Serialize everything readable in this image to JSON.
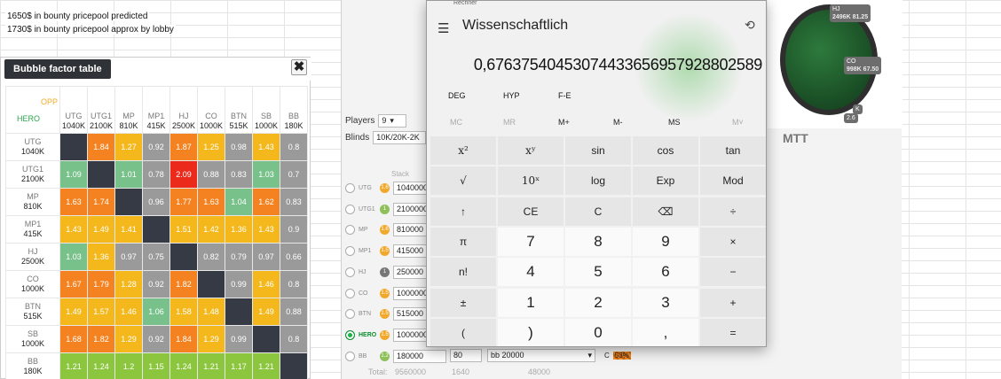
{
  "notes": [
    "1650$ in bounty pricepool predicted",
    "1730$ in bounty pricepool approx by lobby"
  ],
  "bubble": {
    "title": "Bubble factor table",
    "close": "✖",
    "corner_opp": "OPP",
    "corner_hero": "HERO",
    "cols": [
      {
        "pos": "UTG",
        "stack": "1040K"
      },
      {
        "pos": "UTG1",
        "stack": "2100K"
      },
      {
        "pos": "MP",
        "stack": "810K"
      },
      {
        "pos": "MP1",
        "stack": "415K"
      },
      {
        "pos": "HJ",
        "stack": "2500K"
      },
      {
        "pos": "CO",
        "stack": "1000K"
      },
      {
        "pos": "BTN",
        "stack": "515K"
      },
      {
        "pos": "SB",
        "stack": "1000K"
      },
      {
        "pos": "BB",
        "stack": "180K"
      }
    ],
    "rows": [
      {
        "pos": "UTG",
        "stack": "1040K",
        "cells": [
          [
            "",
            "dk"
          ],
          [
            "1.84",
            "or"
          ],
          [
            "1.27",
            "ye"
          ],
          [
            "0.92",
            "gr"
          ],
          [
            "1.87",
            "or"
          ],
          [
            "1.25",
            "ye"
          ],
          [
            "0.98",
            "gr"
          ],
          [
            "1.43",
            "ye"
          ],
          [
            "0.8",
            "gr"
          ]
        ]
      },
      {
        "pos": "UTG1",
        "stack": "2100K",
        "cells": [
          [
            "1.09",
            "gn"
          ],
          [
            "",
            "dk"
          ],
          [
            "1.01",
            "gn"
          ],
          [
            "0.78",
            "gr"
          ],
          [
            "2.09",
            "rd"
          ],
          [
            "0.88",
            "gr"
          ],
          [
            "0.83",
            "gr"
          ],
          [
            "1.03",
            "gn"
          ],
          [
            "0.7",
            "gr"
          ]
        ]
      },
      {
        "pos": "MP",
        "stack": "810K",
        "cells": [
          [
            "1.63",
            "or"
          ],
          [
            "1.74",
            "or"
          ],
          [
            "",
            "dk"
          ],
          [
            "0.96",
            "gr"
          ],
          [
            "1.77",
            "or"
          ],
          [
            "1.63",
            "or"
          ],
          [
            "1.04",
            "gn"
          ],
          [
            "1.62",
            "or"
          ],
          [
            "0.83",
            "gr"
          ]
        ]
      },
      {
        "pos": "MP1",
        "stack": "415K",
        "cells": [
          [
            "1.43",
            "ye"
          ],
          [
            "1.49",
            "ye"
          ],
          [
            "1.41",
            "ye"
          ],
          [
            "",
            "dk"
          ],
          [
            "1.51",
            "ye"
          ],
          [
            "1.42",
            "ye"
          ],
          [
            "1.36",
            "ye"
          ],
          [
            "1.43",
            "ye"
          ],
          [
            "0.9",
            "gr"
          ]
        ]
      },
      {
        "pos": "HJ",
        "stack": "2500K",
        "cells": [
          [
            "1.03",
            "gn"
          ],
          [
            "1.36",
            "ye"
          ],
          [
            "0.97",
            "gr"
          ],
          [
            "0.75",
            "gr"
          ],
          [
            "",
            "dk"
          ],
          [
            "0.82",
            "gr"
          ],
          [
            "0.79",
            "gr"
          ],
          [
            "0.97",
            "gr"
          ],
          [
            "0.66",
            "gr"
          ]
        ]
      },
      {
        "pos": "CO",
        "stack": "1000K",
        "cells": [
          [
            "1.67",
            "or"
          ],
          [
            "1.79",
            "or"
          ],
          [
            "1.28",
            "ye"
          ],
          [
            "0.92",
            "gr"
          ],
          [
            "1.82",
            "or"
          ],
          [
            "",
            "dk"
          ],
          [
            "0.99",
            "gr"
          ],
          [
            "1.46",
            "ye"
          ],
          [
            "0.8",
            "gr"
          ]
        ]
      },
      {
        "pos": "BTN",
        "stack": "515K",
        "cells": [
          [
            "1.49",
            "ye"
          ],
          [
            "1.57",
            "ye"
          ],
          [
            "1.46",
            "ye"
          ],
          [
            "1.06",
            "gn"
          ],
          [
            "1.58",
            "ye"
          ],
          [
            "1.48",
            "ye"
          ],
          [
            "",
            "dk"
          ],
          [
            "1.49",
            "ye"
          ],
          [
            "0.88",
            "gr"
          ]
        ]
      },
      {
        "pos": "SB",
        "stack": "1000K",
        "cells": [
          [
            "1.68",
            "or"
          ],
          [
            "1.82",
            "or"
          ],
          [
            "1.29",
            "ye"
          ],
          [
            "0.92",
            "gr"
          ],
          [
            "1.84",
            "or"
          ],
          [
            "1.29",
            "ye"
          ],
          [
            "0.99",
            "gr"
          ],
          [
            "",
            "dk"
          ],
          [
            "0.8",
            "gr"
          ]
        ]
      },
      {
        "pos": "BB",
        "stack": "180K",
        "cells": [
          [
            "1.21",
            "lg"
          ],
          [
            "1.24",
            "lg"
          ],
          [
            "1.2",
            "lg"
          ],
          [
            "1.15",
            "lg"
          ],
          [
            "1.24",
            "lg"
          ],
          [
            "1.21",
            "lg"
          ],
          [
            "1.17",
            "lg"
          ],
          [
            "1.21",
            "lg"
          ],
          [
            "",
            "dk"
          ]
        ]
      }
    ]
  },
  "app": {
    "players_label": "Players",
    "players_value": "9",
    "blinds_label": "Blinds",
    "blinds_value": "10K/20K-2K",
    "stack_header": "Stack",
    "seats": [
      {
        "pos": "UTG",
        "coin": "1.6",
        "stack": "1040000"
      },
      {
        "pos": "UTG1",
        "coin": "1",
        "stack": "2100000"
      },
      {
        "pos": "MP",
        "coin": "1.6",
        "stack": "810000"
      },
      {
        "pos": "MP1",
        "coin": "1.5",
        "stack": "415000"
      },
      {
        "pos": "HJ",
        "coin": "1",
        "stack": "250000"
      },
      {
        "pos": "CO",
        "coin": "1.5",
        "stack": "1000000"
      },
      {
        "pos": "BTN",
        "coin": "1.5",
        "stack": "515000"
      },
      {
        "pos": "HERO",
        "coin": "1.5",
        "stack": "1000000"
      },
      {
        "pos": "BB",
        "coin": "1.2",
        "stack": "180000"
      }
    ],
    "bb_extra": "80",
    "bb_select": "bb 20000",
    "total_label": "Total:",
    "total_values": [
      "9560000",
      "1640",
      "48000"
    ],
    "mtt": "MTT",
    "pct": "53%",
    "pct_prefix": "C",
    "table_seats": [
      {
        "name": "HJ",
        "val": "2496K 81.25"
      },
      {
        "name": "CO",
        "val": "998K 67.50"
      },
      {
        "name": "K",
        "val": ""
      },
      {
        "name": "",
        "val": "2.6"
      }
    ]
  },
  "calc": {
    "titlebar": "Rechner",
    "mode": "Wissenschaftlich",
    "display": "0,676375404530744336569579288025 89",
    "display_text": "0,6763754045307443365695792880258 9",
    "display_shown": "0,676375404530744336569579288025 89",
    "value": "0,67637540453074433656957928802589",
    "modes": [
      "DEG",
      "HYP",
      "F-E"
    ],
    "memory": [
      "MC",
      "MR",
      "M+",
      "M-",
      "MS",
      "M˅"
    ],
    "keys": [
      [
        "x²",
        "xʸ",
        "sin",
        "cos",
        "tan"
      ],
      [
        "√",
        "10ˣ",
        "log",
        "Exp",
        "Mod"
      ],
      [
        "↑",
        "CE",
        "C",
        "⌫",
        "÷"
      ],
      [
        "π",
        "7",
        "8",
        "9",
        "×"
      ],
      [
        "n!",
        "4",
        "5",
        "6",
        "−"
      ],
      [
        "±",
        "1",
        "2",
        "3",
        "+"
      ],
      [
        "(",
        ")",
        "0",
        ",",
        "="
      ]
    ]
  }
}
